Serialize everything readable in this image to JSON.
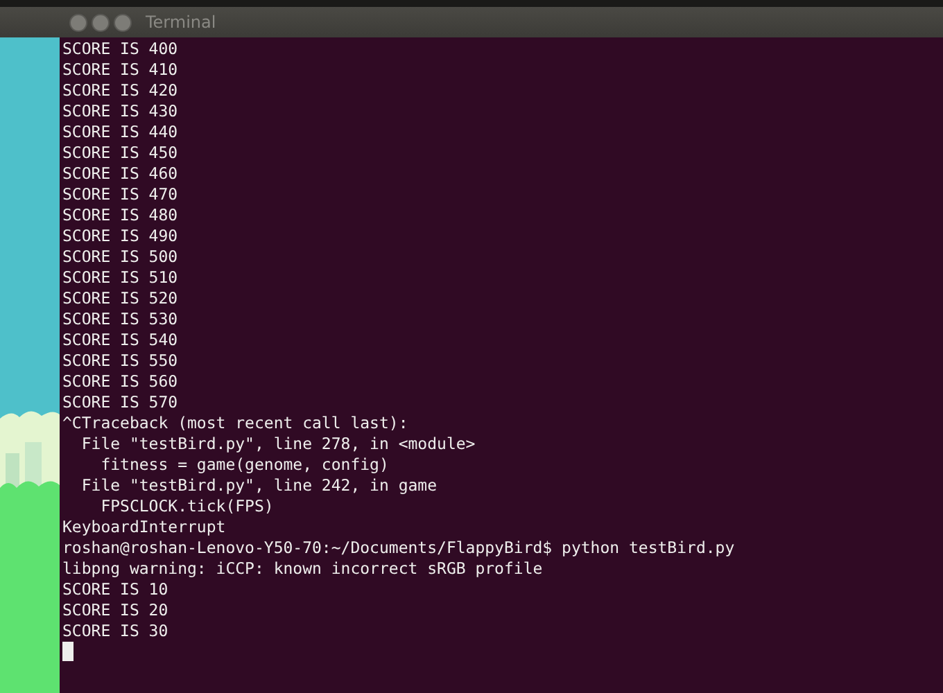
{
  "window": {
    "title": "Terminal"
  },
  "terminal": {
    "lines": [
      "SCORE IS 400",
      "SCORE IS 410",
      "SCORE IS 420",
      "SCORE IS 430",
      "SCORE IS 440",
      "SCORE IS 450",
      "SCORE IS 460",
      "SCORE IS 470",
      "SCORE IS 480",
      "SCORE IS 490",
      "SCORE IS 500",
      "SCORE IS 510",
      "SCORE IS 520",
      "SCORE IS 530",
      "SCORE IS 540",
      "SCORE IS 550",
      "SCORE IS 560",
      "SCORE IS 570",
      "^CTraceback (most recent call last):",
      "  File \"testBird.py\", line 278, in <module>",
      "    fitness = game(genome, config)",
      "  File \"testBird.py\", line 242, in game",
      "    FPSCLOCK.tick(FPS)",
      "KeyboardInterrupt",
      "roshan@roshan-Lenovo-Y50-70:~/Documents/FlappyBird$ python testBird.py",
      "libpng warning: iCCP: known incorrect sRGB profile",
      "SCORE IS 10",
      "SCORE IS 20",
      "SCORE IS 30"
    ]
  }
}
